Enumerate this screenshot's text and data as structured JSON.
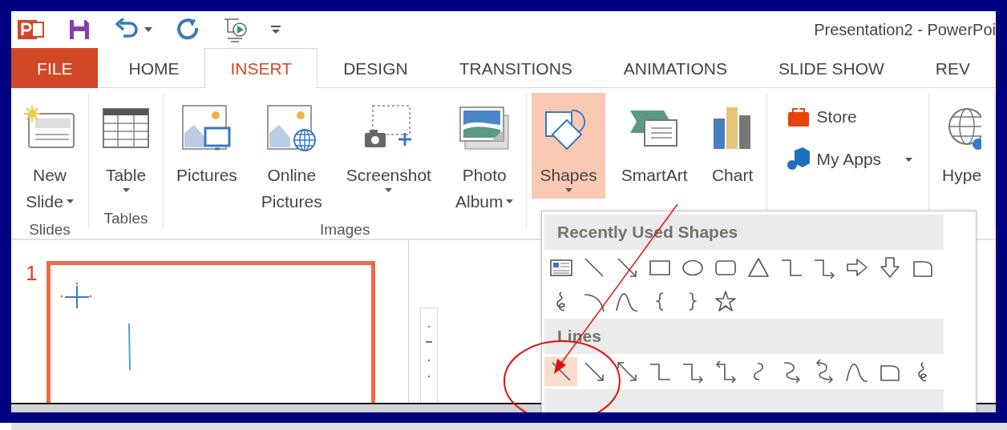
{
  "quick_access": {
    "title": "Presentation2 - PowerPoi"
  },
  "tabs": [
    {
      "label": "FILE",
      "kind": "file",
      "selected": false
    },
    {
      "label": "HOME",
      "kind": "tab",
      "selected": false
    },
    {
      "label": "INSERT",
      "kind": "tab",
      "selected": true
    },
    {
      "label": "DESIGN",
      "kind": "tab",
      "selected": false
    },
    {
      "label": "TRANSITIONS",
      "kind": "tab",
      "selected": false
    },
    {
      "label": "ANIMATIONS",
      "kind": "tab",
      "selected": false
    },
    {
      "label": "SLIDE SHOW",
      "kind": "tab",
      "selected": false
    },
    {
      "label": "REV",
      "kind": "tab",
      "selected": false
    }
  ],
  "ribbon": {
    "groups": [
      {
        "label": "Slides",
        "buttons": [
          {
            "kind": "new-slide",
            "lines": [
              "New",
              "Slide"
            ],
            "dropdown": true,
            "expanded": false
          }
        ]
      },
      {
        "label": "Tables",
        "buttons": [
          {
            "kind": "table",
            "lines": [
              "Table"
            ],
            "dropdown": true,
            "expanded": false
          }
        ]
      },
      {
        "label": "Images",
        "buttons": [
          {
            "kind": "pictures",
            "lines": [
              "Pictures"
            ],
            "dropdown": false,
            "expanded": false
          },
          {
            "kind": "online-pictures",
            "lines": [
              "Online",
              "Pictures"
            ],
            "dropdown": false,
            "expanded": false
          },
          {
            "kind": "screenshot",
            "lines": [
              "Screenshot"
            ],
            "dropdown": true,
            "expanded": false
          },
          {
            "kind": "photo-album",
            "lines": [
              "Photo",
              "Album"
            ],
            "dropdown": true,
            "expanded": false
          }
        ]
      },
      {
        "buttons": [
          {
            "kind": "shapes",
            "lines": [
              "Shapes"
            ],
            "dropdown": true,
            "expanded": true
          },
          {
            "kind": "smartart",
            "lines": [
              "SmartArt"
            ],
            "dropdown": false,
            "expanded": false
          },
          {
            "kind": "chart",
            "lines": [
              "Chart"
            ],
            "dropdown": false,
            "expanded": false
          }
        ]
      },
      {
        "buttons": [
          {
            "kind": "store",
            "lines": [
              "Store"
            ],
            "dropdown": false,
            "expanded": false
          },
          {
            "kind": "my-apps",
            "lines": [
              "My Apps"
            ],
            "dropdown": true,
            "expanded": false
          }
        ]
      },
      {
        "buttons": [
          {
            "kind": "hyperlink",
            "lines": [
              "Hype"
            ],
            "dropdown": false,
            "expanded": false
          }
        ]
      }
    ]
  },
  "slides": [
    {
      "number": "1",
      "selected": true
    }
  ],
  "shapes_menu": {
    "sections": [
      {
        "title": "Recently Used Shapes",
        "shapes": [
          {
            "kind": "textbox",
            "selected": false
          },
          {
            "kind": "line",
            "selected": false
          },
          {
            "kind": "arrow",
            "selected": false
          },
          {
            "kind": "rectangle",
            "selected": false
          },
          {
            "kind": "oval",
            "selected": false
          },
          {
            "kind": "rounded-rectangle",
            "selected": false
          },
          {
            "kind": "triangle",
            "selected": false
          },
          {
            "kind": "elbow",
            "selected": false
          },
          {
            "kind": "elbow-arrow",
            "selected": false
          },
          {
            "kind": "right-arrow",
            "selected": false
          },
          {
            "kind": "down-arrow",
            "selected": false
          },
          {
            "kind": "freeform",
            "selected": false
          },
          {
            "kind": "scribble",
            "selected": false
          },
          {
            "kind": "arc",
            "selected": false
          },
          {
            "kind": "curve",
            "selected": false
          },
          {
            "kind": "left-brace",
            "selected": false
          },
          {
            "kind": "right-brace",
            "selected": false
          },
          {
            "kind": "star",
            "selected": false
          }
        ]
      },
      {
        "title": "Lines",
        "shapes": [
          {
            "kind": "line",
            "selected": true
          },
          {
            "kind": "arrow",
            "selected": false
          },
          {
            "kind": "double-arrow",
            "selected": false
          },
          {
            "kind": "elbow",
            "selected": false
          },
          {
            "kind": "elbow-arrow",
            "selected": false
          },
          {
            "kind": "elbow-double-arrow",
            "selected": false
          },
          {
            "kind": "curved",
            "selected": false
          },
          {
            "kind": "curved-arrow",
            "selected": false
          },
          {
            "kind": "curved-double-arrow",
            "selected": false
          },
          {
            "kind": "curve",
            "selected": false
          },
          {
            "kind": "freeform",
            "selected": false
          },
          {
            "kind": "scribble",
            "selected": false
          }
        ]
      }
    ]
  }
}
